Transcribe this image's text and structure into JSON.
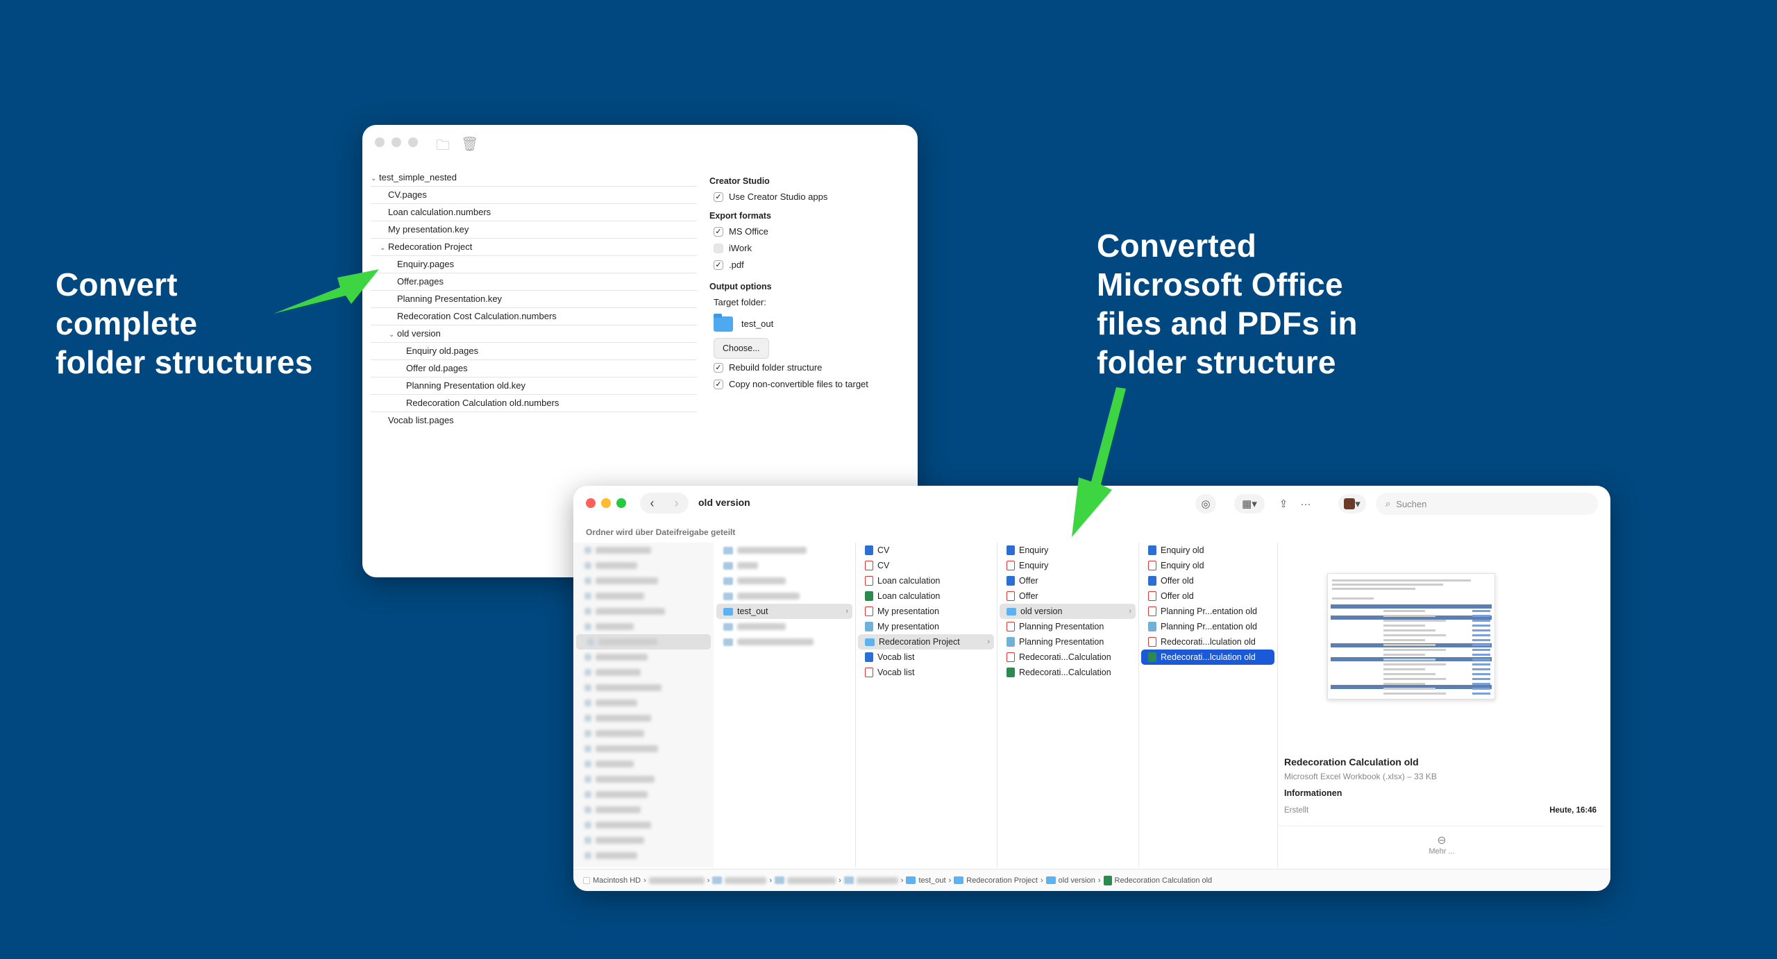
{
  "headline_left": [
    "Convert",
    "complete",
    "folder structures"
  ],
  "headline_right": [
    "Converted",
    "Microsoft Office",
    "files  and PDFs in",
    "folder structure"
  ],
  "colors": {
    "background": "#00487f",
    "arrow": "#3dd642",
    "selection": "#1a5ad9"
  },
  "app": {
    "tree": [
      {
        "label": "test_simple_nested",
        "level": 0,
        "expanded": true
      },
      {
        "label": "CV.pages",
        "level": 1
      },
      {
        "label": "Loan calculation.numbers",
        "level": 1
      },
      {
        "label": "My presentation.key",
        "level": 1
      },
      {
        "label": "Redecoration Project",
        "level": 1,
        "expanded": true
      },
      {
        "label": "Enquiry.pages",
        "level": 2
      },
      {
        "label": "Offer.pages",
        "level": 2
      },
      {
        "label": "Planning Presentation.key",
        "level": 2
      },
      {
        "label": "Redecoration Cost Calculation.numbers",
        "level": 2
      },
      {
        "label": "old version",
        "level": 2,
        "expanded": true
      },
      {
        "label": "Enquiry old.pages",
        "level": 3
      },
      {
        "label": "Offer old.pages",
        "level": 3
      },
      {
        "label": "Planning Presentation old.key",
        "level": 3
      },
      {
        "label": "Redecoration Calculation old.numbers",
        "level": 3
      },
      {
        "label": "Vocab list.pages",
        "level": 1
      }
    ],
    "options": {
      "creator_heading": "Creator Studio",
      "use_creator": "Use Creator Studio apps",
      "export_heading": "Export formats",
      "ms_office": "MS Office",
      "iwork": "iWork",
      "pdf": ".pdf",
      "output_heading": "Output options",
      "target_label": "Target folder:",
      "target_folder": "test_out",
      "choose_button": "Choose...",
      "rebuild": "Rebuild folder structure",
      "copy_nonconv": "Copy non-convertible files to target"
    }
  },
  "finder": {
    "title": "old version",
    "share_note": "Ordner wird über Dateifreigabe geteilt",
    "search_placeholder": "Suchen",
    "col2_selected": "test_out",
    "col3": [
      {
        "label": "CV",
        "icon": "word"
      },
      {
        "label": "CV",
        "icon": "pdf"
      },
      {
        "label": "Loan calculation",
        "icon": "pdf"
      },
      {
        "label": "Loan calculation",
        "icon": "xls"
      },
      {
        "label": "My presentation",
        "icon": "pdf"
      },
      {
        "label": "My presentation",
        "icon": "ppt"
      },
      {
        "label": "Redecoration Project",
        "icon": "folder",
        "selected": true
      },
      {
        "label": "Vocab list",
        "icon": "word"
      },
      {
        "label": "Vocab list",
        "icon": "pdf"
      }
    ],
    "col4": [
      {
        "label": "Enquiry",
        "icon": "word"
      },
      {
        "label": "Enquiry",
        "icon": "pdf"
      },
      {
        "label": "Offer",
        "icon": "word"
      },
      {
        "label": "Offer",
        "icon": "pdf"
      },
      {
        "label": "old version",
        "icon": "folder",
        "selected": true
      },
      {
        "label": "Planning Presentation",
        "icon": "pdf"
      },
      {
        "label": "Planning Presentation",
        "icon": "ppt"
      },
      {
        "label": "Redecorati...Calculation",
        "icon": "pdf"
      },
      {
        "label": "Redecorati...Calculation",
        "icon": "xls"
      }
    ],
    "col5": [
      {
        "label": "Enquiry old",
        "icon": "word"
      },
      {
        "label": "Enquiry old",
        "icon": "pdf"
      },
      {
        "label": "Offer old",
        "icon": "word"
      },
      {
        "label": "Offer old",
        "icon": "pdf"
      },
      {
        "label": "Planning Pr...entation old",
        "icon": "pdf"
      },
      {
        "label": "Planning Pr...entation old",
        "icon": "ppt"
      },
      {
        "label": "Redecorati...lculation old",
        "icon": "pdf"
      },
      {
        "label": "Redecorati...lculation old",
        "icon": "xls",
        "active": true
      }
    ],
    "preview": {
      "title": "Redecoration Calculation old",
      "subtitle": "Microsoft Excel Workbook (.xlsx) – 33 KB",
      "info_heading": "Informationen",
      "created_label": "Erstellt",
      "created_value": "Heute, 16:46",
      "more": "Mehr ..."
    },
    "path": [
      "Macintosh HD",
      "test_out",
      "Redecoration Project",
      "old version",
      "Redecoration Calculation old"
    ]
  }
}
